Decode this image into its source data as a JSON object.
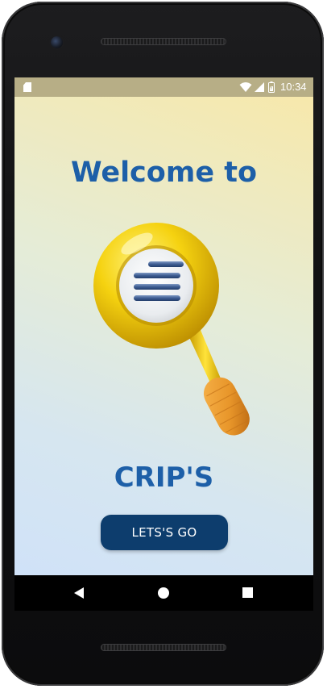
{
  "status_bar": {
    "time": "10:34",
    "icons": [
      "sd-card-icon",
      "wifi-icon",
      "signal-icon",
      "battery-icon"
    ]
  },
  "welcome": {
    "title": "Welcome to",
    "illustration": "magnifying-glass-icon",
    "brand": "CRIP'S",
    "button_label": "LETS'S GO"
  },
  "nav_bar": {
    "icons": [
      "back-icon",
      "home-icon",
      "recents-icon"
    ]
  },
  "colors": {
    "title": "#1d5fa8",
    "button": "#0d3d6d",
    "status_bar": "#b7ae86",
    "lens_frame": "#f5d210",
    "handle": "#e8962a"
  }
}
